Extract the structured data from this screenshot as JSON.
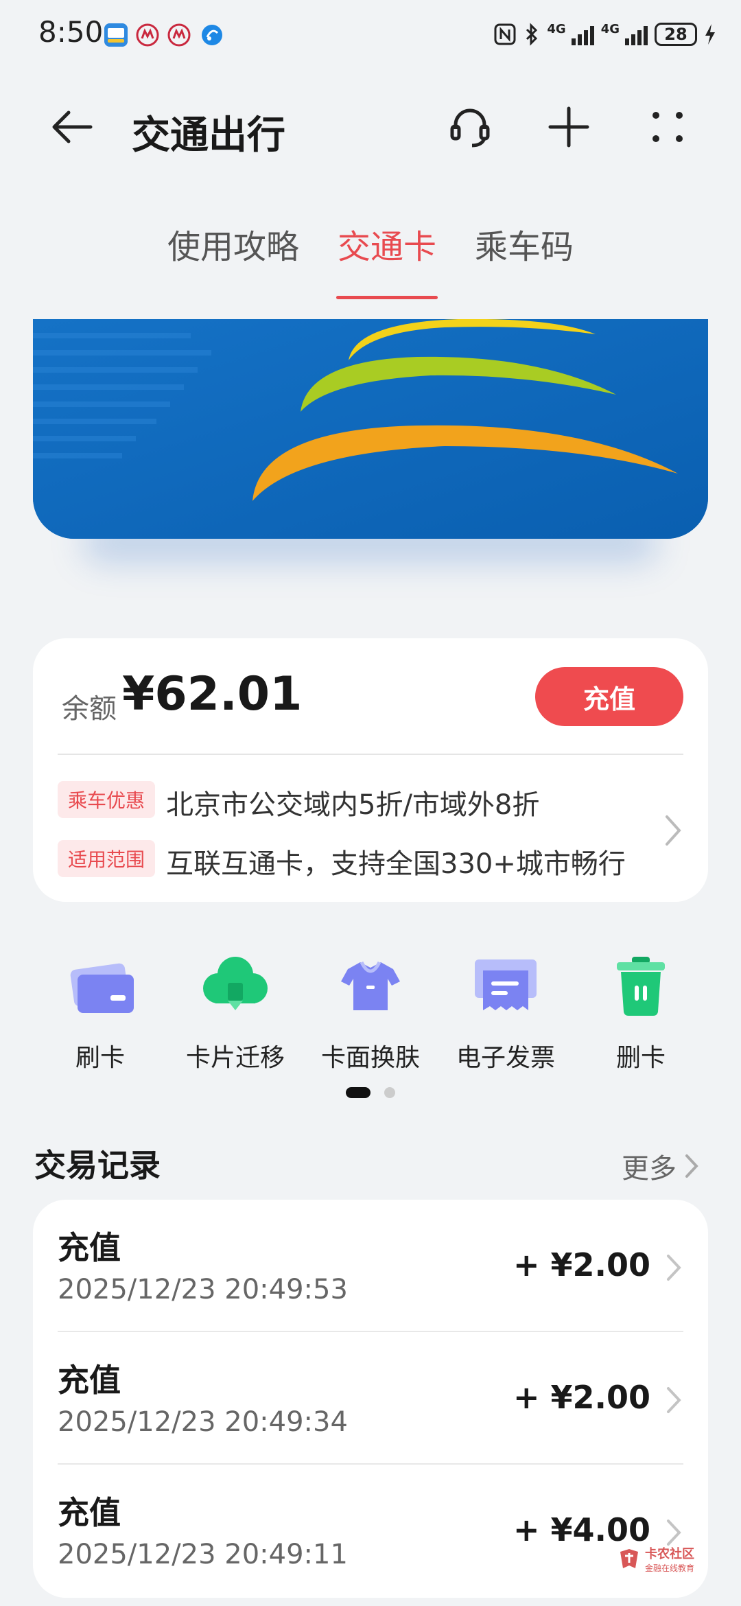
{
  "status_bar": {
    "time": "8:50",
    "net1": "4G",
    "net2": "4G",
    "battery": "28"
  },
  "header": {
    "title": "交通出行"
  },
  "tabs": [
    {
      "label": "使用攻略",
      "active": false
    },
    {
      "label": "交通卡",
      "active": true
    },
    {
      "label": "乘车码",
      "active": false
    }
  ],
  "balance": {
    "label": "余额",
    "value": "¥62.01",
    "recharge_label": "充值"
  },
  "benefits": [
    {
      "tag": "乘车优惠",
      "text": "北京市公交域内5折/市域外8折"
    },
    {
      "tag": "适用范围",
      "text": "互联互通卡，支持全国330+城市畅行"
    }
  ],
  "actions": [
    {
      "label": "刷卡",
      "icon": "card-swipe-icon"
    },
    {
      "label": "卡片迁移",
      "icon": "cloud-transfer-icon"
    },
    {
      "label": "卡面换肤",
      "icon": "shirt-icon"
    },
    {
      "label": "电子发票",
      "icon": "invoice-icon"
    },
    {
      "label": "删卡",
      "icon": "trash-icon"
    }
  ],
  "transactions": {
    "title": "交易记录",
    "more_label": "更多",
    "items": [
      {
        "type": "充值",
        "datetime": "2025/12/23 20:49:53",
        "amount": "+ ¥2.00"
      },
      {
        "type": "充值",
        "datetime": "2025/12/23 20:49:34",
        "amount": "+ ¥2.00"
      },
      {
        "type": "充值",
        "datetime": "2025/12/23 20:49:11",
        "amount": "+ ¥4.00"
      }
    ]
  },
  "watermark": {
    "name": "卡农社区",
    "slogan": "金融在线教育"
  },
  "colors": {
    "accent": "#e84a4f",
    "card_blue": "#0e67ba",
    "icon_purple": "#7b83f2",
    "icon_green": "#1fc878"
  }
}
